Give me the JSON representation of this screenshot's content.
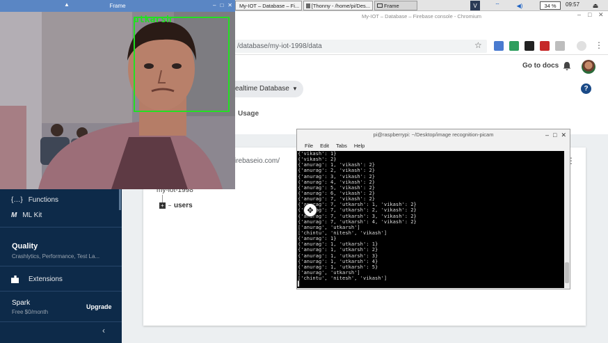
{
  "taskbar": {
    "tasks": [
      {
        "label": "Frame"
      },
      {
        "label": "My-IOT – Database – Fi..."
      },
      {
        "label": "[Thonny - /home/pi/Des..."
      },
      {
        "label": "Frame"
      }
    ],
    "battery": "34 %",
    "clock": "09:57"
  },
  "browser": {
    "window_title": "My-IOT – Database – Firebase console - Chromium",
    "url": "/database/my-iot-1998/data"
  },
  "firebase": {
    "go_to_docs": "Go to docs",
    "help": "?",
    "db_selector": "ealtime Database",
    "usage_tab": "Usage",
    "db_url_fragment": "irebaseio.com/",
    "root_node": "my-iot-1998",
    "child_node": "users",
    "expand_glyph": "+"
  },
  "sidebar": {
    "functions": "Functions",
    "functions_icon": "{…}",
    "mlkit": "ML Kit",
    "quality_title": "Quality",
    "quality_sub": "Crashlytics, Performance, Test La...",
    "extensions": "Extensions",
    "spark_title": "Spark",
    "spark_sub": "Free $0/month",
    "upgrade": "Upgrade",
    "collapse": "‹"
  },
  "frame": {
    "title": "Frame",
    "face_label": "utkarsh"
  },
  "terminal": {
    "title": "pi@raspberrypi: ~/Desktop/image recognition-picam",
    "menu": [
      "File",
      "Edit",
      "Tabs",
      "Help"
    ],
    "lines": [
      "{'vikash': 1}",
      "{'vikash': 2}",
      "{'anurag': 1, 'vikash': 2}",
      "{'anurag': 2, 'vikash': 2}",
      "{'anurag': 3, 'vikash': 2}",
      "{'anurag': 4, 'vikash': 2}",
      "{'anurag': 5, 'vikash': 2}",
      "{'anurag': 6, 'vikash': 2}",
      "{'anurag': 7, 'vikash': 2}",
      "{'anurag': 7, 'utkarsh': 1, 'vikash': 2}",
      "{'anurag': 7, 'utkarsh': 2, 'vikash': 2}",
      "{'anurag': 7, 'utkarsh': 3, 'vikash': 2}",
      "{'anurag': 7, 'utkarsh': 4, 'vikash': 2}",
      "['anurag', 'utkarsh']",
      "['chintu', 'nitesh', 'vikash']",
      "{'anurag': 1}",
      "{'anurag': 1, 'utkarsh': 1}",
      "{'anurag': 1, 'utkarsh': 2}",
      "{'anurag': 1, 'utkarsh': 3}",
      "{'anurag': 1, 'utkarsh': 4}",
      "{'anurag': 1, 'utkarsh': 5}",
      "['anurag', 'utkarsh']",
      "['chintu', 'nitesh', 'vikash']",
      "▌"
    ]
  },
  "colors": {
    "sidebar_bg": "#0d2a49",
    "frame_titlebar": "#5a86c4",
    "face_box": "#22e022",
    "help_badge": "#1a4a87"
  }
}
